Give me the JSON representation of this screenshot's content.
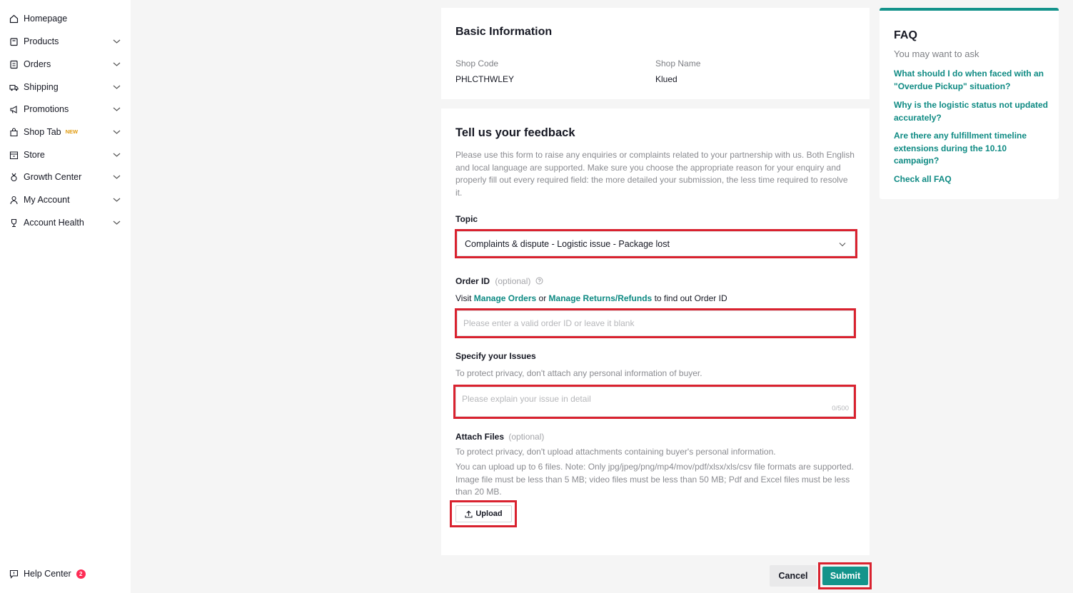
{
  "sidebar": {
    "items": [
      {
        "label": "Homepage",
        "icon": "home-icon"
      },
      {
        "label": "Products",
        "icon": "products-icon"
      },
      {
        "label": "Orders",
        "icon": "orders-icon"
      },
      {
        "label": "Shipping",
        "icon": "shipping-icon"
      },
      {
        "label": "Promotions",
        "icon": "megaphone-icon"
      },
      {
        "label": "Shop Tab",
        "icon": "shop-bag-icon",
        "badge": "NEW"
      },
      {
        "label": "Store",
        "icon": "store-icon"
      },
      {
        "label": "Growth Center",
        "icon": "medal-icon"
      },
      {
        "label": "My Account",
        "icon": "user-icon"
      },
      {
        "label": "Account Health",
        "icon": "trophy-icon"
      }
    ],
    "help": {
      "label": "Help Center",
      "count": "2",
      "icon": "help-chat-icon"
    }
  },
  "basic_info": {
    "title": "Basic Information",
    "shop_code_label": "Shop Code",
    "shop_code": "PHLCTHWLEY",
    "shop_name_label": "Shop Name",
    "shop_name": "Klued"
  },
  "feedback": {
    "title": "Tell us your feedback",
    "description": "Please use this form to raise any enquiries or complaints related to your partnership with us. Both English and local language are supported. Make sure you choose the appropriate reason for your enquiry and properly fill out every required field: the more detailed your submission, the less time required to resolve it.",
    "topic_label": "Topic",
    "topic_value": "Complaints & dispute - Logistic issue - Package lost",
    "order_id_label": "Order ID",
    "optional": "(optional)",
    "order_hint_prefix": "Visit",
    "manage_orders": "Manage Orders",
    "order_hint_or": "or",
    "manage_returns": "Manage Returns/Refunds",
    "order_hint_suffix": "to find out Order ID",
    "order_placeholder": "Please enter a valid order ID or leave it blank",
    "issues_label": "Specify your Issues",
    "issues_hint": "To protect privacy, don't attach any personal information of buyer.",
    "issues_placeholder": "Please explain your issue in detail",
    "issues_counter": "0/500",
    "attach_label": "Attach Files",
    "attach_optional": "(optional)",
    "attach_hint1": "To protect privacy, don't upload attachments containing buyer's personal information.",
    "attach_hint2": "You can upload up to 6 files. Note: Only jpg/jpeg/png/mp4/mov/pdf/xlsx/xls/csv file formats are supported. Image file must be less than 5 MB; video files must be less than 50 MB; Pdf and Excel files must be less than 20 MB.",
    "upload_label": "Upload"
  },
  "faq": {
    "title": "FAQ",
    "subtitle": "You may want to ask",
    "questions": [
      "What should I do when faced with an \"Overdue Pickup\" situation?",
      "Why is the logistic status not updated accurately?",
      "Are there any fulfillment timeline extensions during the 10.10 campaign?"
    ],
    "check_all": "Check all FAQ"
  },
  "actions": {
    "cancel": "Cancel",
    "submit": "Submit"
  },
  "colors": {
    "accent": "#13948b",
    "highlight": "#d9222f",
    "badge_new": "#e09b10"
  }
}
